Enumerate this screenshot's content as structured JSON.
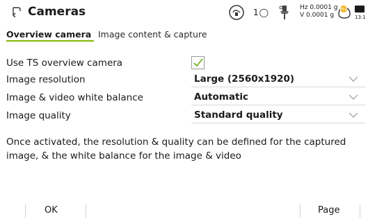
{
  "header": {
    "title": "Cameras",
    "level_indicator": "1◯",
    "angle_hz": "Hz 0.0001 g",
    "angle_v": "V  0.0001 g",
    "battery_time": "13:1"
  },
  "tabs": [
    {
      "label": "Overview camera",
      "active": true
    },
    {
      "label": "Image content & capture",
      "active": false
    }
  ],
  "form": {
    "use_ts_camera_label": "Use TS overview camera",
    "use_ts_camera_checked": true,
    "resolution_label": "Image resolution",
    "resolution_value": "Large (2560x1920)",
    "white_balance_label": "Image & video white balance",
    "white_balance_value": "Automatic",
    "quality_label": "Image quality",
    "quality_value": "Standard quality"
  },
  "info_text": "Once activated, the resolution & quality can be defined for the captured image, & the white balance for the image & video",
  "softkeys": {
    "ok_label": "OK",
    "page_label": "Page"
  },
  "colors": {
    "accent_green": "#7fb800",
    "check_green": "#6fae1a"
  },
  "icons": [
    "back-icon",
    "compensator-icon",
    "level-icon",
    "prism-icon",
    "radio-icon",
    "battery-icon",
    "chevron-down-icon",
    "checkmark-icon"
  ]
}
